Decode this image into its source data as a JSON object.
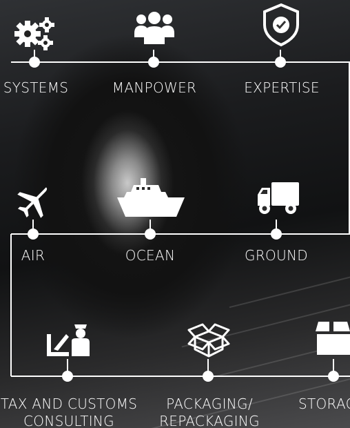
{
  "rows": [
    {
      "items": [
        {
          "label": "SYSTEMS",
          "icon": "gears-icon"
        },
        {
          "label": "MANPOWER",
          "icon": "people-group-icon"
        },
        {
          "label": "EXPERTISE",
          "icon": "shield-check-icon"
        }
      ]
    },
    {
      "items": [
        {
          "label": "AIR",
          "icon": "airplane-icon"
        },
        {
          "label": "OCEAN",
          "icon": "ship-icon"
        },
        {
          "label": "GROUND",
          "icon": "truck-icon"
        }
      ]
    },
    {
      "items": [
        {
          "label_line1": "TAX AND CUSTOMS",
          "label_line2": "CONSULTING",
          "icon": "customs-officer-icon"
        },
        {
          "label_line1": "PACKAGING/",
          "label_line2": "REPACKAGING",
          "icon": "open-box-icon"
        },
        {
          "label": "STORAG",
          "icon": "storage-box-icon"
        }
      ]
    }
  ],
  "colors": {
    "line": "#ffffff",
    "text": "#ffffff",
    "background": "#1a1b1d"
  }
}
